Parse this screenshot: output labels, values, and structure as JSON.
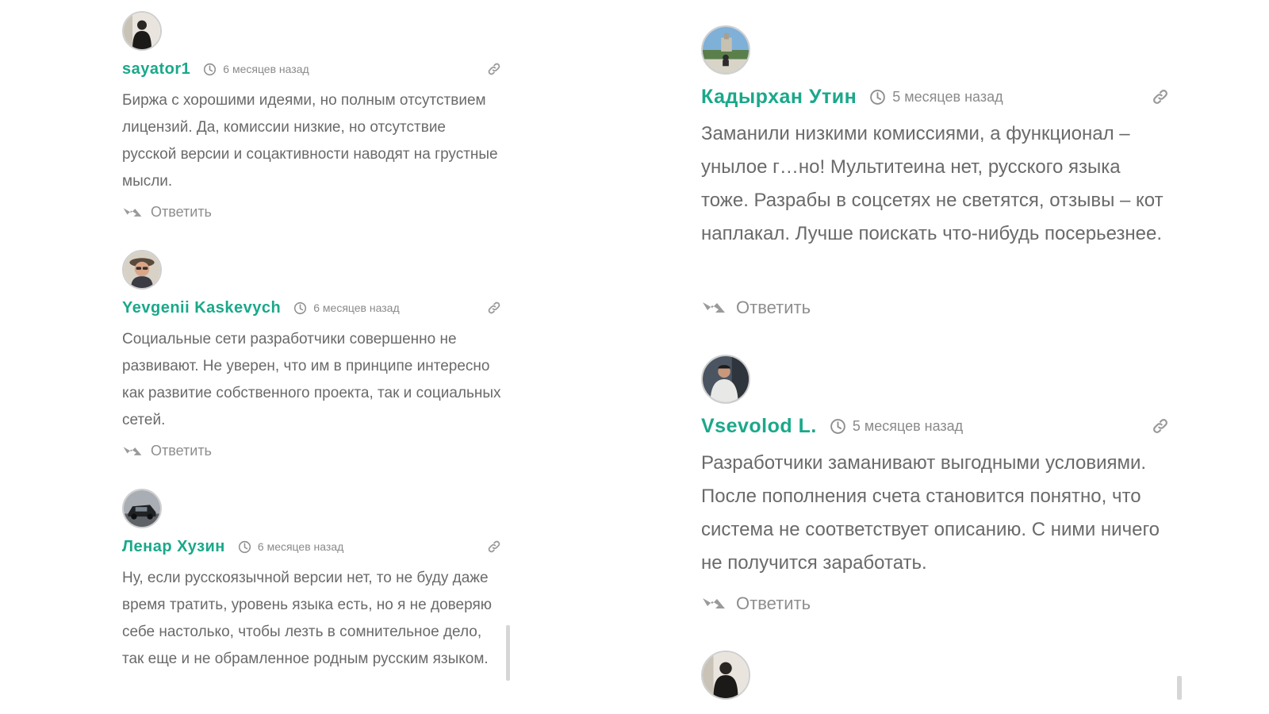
{
  "left_column": {
    "comments": [
      {
        "author": "sayator1",
        "time": "6 месяцев назад",
        "text": "Биржа с хорошими идеями, но полным отсутствием лицензий. Да, комиссии низкие, но отсутствие русской версии и соцактивности наводят на грустные мысли.",
        "reply_label": "Ответить",
        "avatar": "avatar-man-dark-jacket"
      },
      {
        "author": "Yevgenii Kaskevych",
        "time": "6 месяцев назад",
        "text": "Социальные сети разработчики совершенно не развивают. Не уверен, что им в принципе интересно как развитие собственного проекта, так и социальных сетей.",
        "reply_label": "Ответить",
        "avatar": "avatar-man-glasses-hat"
      },
      {
        "author": "Ленар Хузин",
        "time": "6 месяцев назад",
        "text": "Ну, если русскоязычной версии нет, то не буду даже время тратить, уровень языка есть, но я не доверяю себе настолько, чтобы лезть в сомнительное дело, так еще и не обрамленное родным русским языком.",
        "reply_label": "",
        "avatar": "avatar-car"
      }
    ]
  },
  "right_column": {
    "comments": [
      {
        "author": "Кадырхан Утин",
        "time": "5 месяцев назад",
        "text": "Заманили низкими комиссиями, а функционал – унылое г…но! Мультитеина нет, русского языка тоже. Разрабы в соцсетях не светятся, отзывы – кот наплакал. Лучше поискать что-нибудь посерьезнее.",
        "reply_label": "Ответить",
        "avatar": "avatar-landscape"
      },
      {
        "author": "Vsevolod L.",
        "time": "5 месяцев назад",
        "text": "Разработчики заманивают выгодными условиями. После пополнения счета становится понятно, что система не соответствует описанию. С ними ничего не получится заработать.",
        "reply_label": "Ответить",
        "avatar": "avatar-man-white-shirt"
      }
    ],
    "partial_avatar": "avatar-man-dark-jacket"
  },
  "icons": {
    "time": "clock-icon",
    "permalink": "link-icon",
    "reply": "reply-arrow-icon"
  },
  "colors": {
    "author": "#1aa88a",
    "text": "#6a6a6a",
    "meta": "#8a8a8a"
  }
}
